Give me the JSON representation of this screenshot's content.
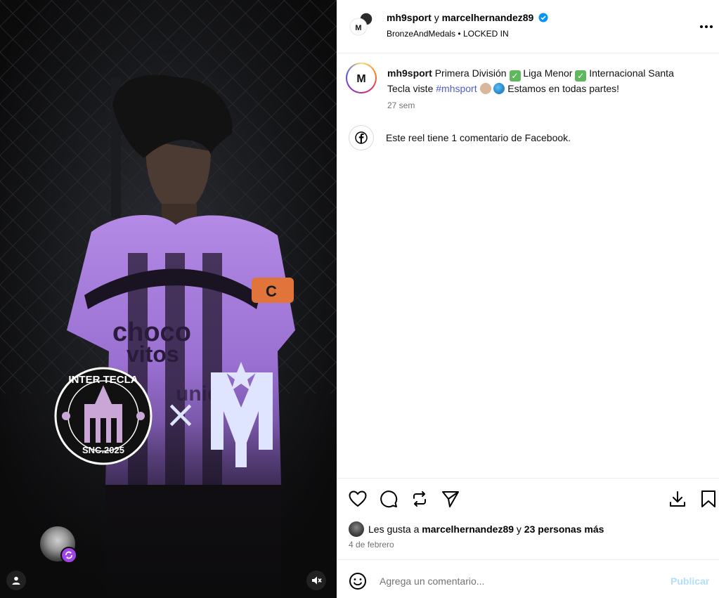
{
  "header": {
    "user_primary": "mh9sport",
    "conjunction": "y",
    "user_secondary": "marcelhernandez89",
    "audio_artist": "BronzeAndMedals",
    "separator": "•",
    "audio_track": "LOCKED IN",
    "more_icon": "more-horizontal-icon"
  },
  "media": {
    "jersey_text_1": "choco",
    "jersey_text_2": "vitos",
    "jersey_text_3": "uniqu",
    "badge_top_text": "INTER TECLA",
    "badge_bottom_text": "SNC.2025",
    "cross_symbol": "×",
    "accent_color": "#9b6fd6",
    "logo_color": "#dfe4ff"
  },
  "caption": {
    "username": "mh9sport",
    "segment_1": "Primera División",
    "segment_2": "Liga Menor",
    "segment_3": "Internacional Santa Tecla viste",
    "hashtag": "#mhsport",
    "segment_4": "Estamos en todas partes!",
    "check_glyph": "✓",
    "time_ago": "27 sem"
  },
  "facebook": {
    "text": "Este reel tiene 1 comentario de Facebook."
  },
  "actions": {
    "like_icon": "heart-icon",
    "comment_icon": "comment-icon",
    "repost_icon": "repost-icon",
    "share_icon": "send-icon",
    "download_icon": "download-icon",
    "save_icon": "bookmark-icon"
  },
  "likes": {
    "prefix": "Les gusta a",
    "user": "marcelhernandez89",
    "conjunction": "y",
    "others": "23 personas más"
  },
  "date": "4 de febrero",
  "comment": {
    "placeholder": "Agrega un comentario...",
    "publish_label": "Publicar",
    "publish_color": "#b2dffc"
  }
}
